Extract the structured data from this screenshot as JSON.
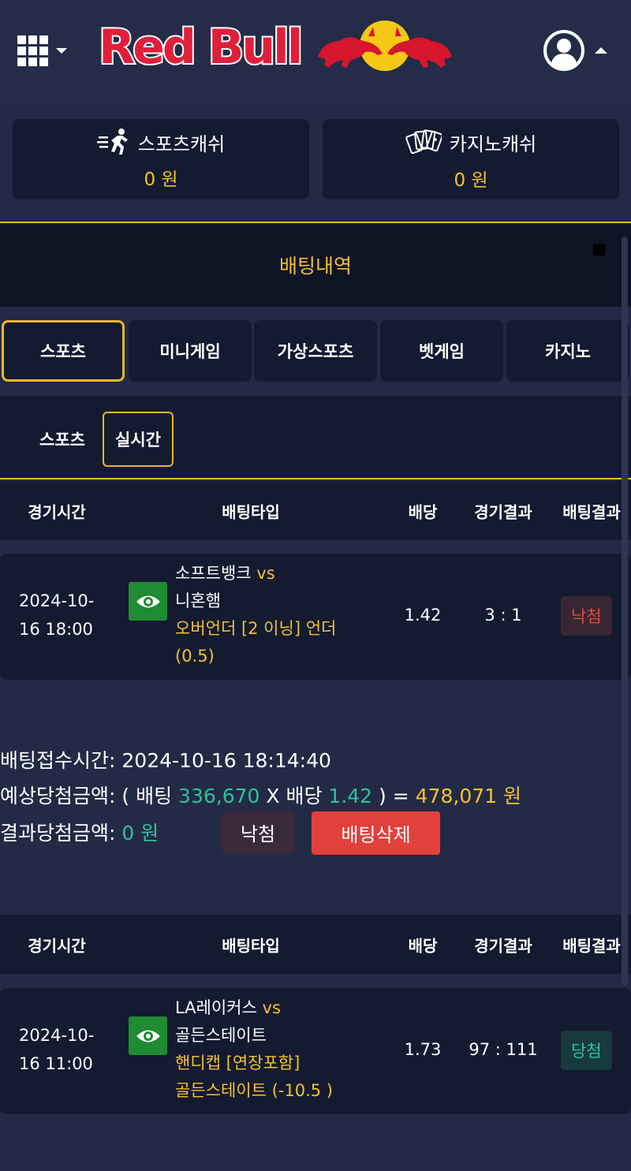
{
  "header": {
    "logo_text": "Red Bull",
    "icons": [
      "grid-menu-icon",
      "chevron-down-icon",
      "red-bull-bulls-logo",
      "user-avatar-icon",
      "caret-up-icon"
    ]
  },
  "cash": [
    {
      "label": "스포츠캐쉬",
      "value": "0 원",
      "icon": "running-sports-icon"
    },
    {
      "label": "카지노캐쉬",
      "value": "0 원",
      "icon": "playing-cards-icon"
    }
  ],
  "section_title": "배팅내역",
  "tabs": [
    "스포츠",
    "미니게임",
    "가상스포츠",
    "벳게임",
    "카지노"
  ],
  "subtabs": [
    "스포츠",
    "실시간"
  ],
  "table_headers": [
    "경기시간",
    "배팅타입",
    "배당",
    "경기결과",
    "배팅결과"
  ],
  "bets": [
    {
      "date_line1": "2024-10-",
      "date_line2": "16 18:00",
      "team_home": "소프트뱅크",
      "vs": "vs",
      "team_away": "니혼햄",
      "market_line1": "오버언더 [2 이닝] 언더",
      "market_line2": "(0.5)",
      "odds": "1.42",
      "score": "3 : 1",
      "result": "낙첨",
      "receipt": {
        "time_label": "배팅접수시간:",
        "time_value": "2024-10-16 18:14:40",
        "expected_label": "예상당첨금액:",
        "expected_open": "( 배팅",
        "stake": "336,670",
        "times": "X 배당",
        "odds": "1.42",
        "equals": ") =",
        "expected_amount": "478,071 원",
        "result_label": "결과당첨금액:",
        "result_amount": "0 원",
        "status_button": "낙첨",
        "delete_button": "배팅삭제"
      }
    },
    {
      "date_line1": "2024-10-",
      "date_line2": "16 11:00",
      "team_home": "LA레이커스",
      "vs": "vs",
      "team_away": "골든스테이트",
      "market_line1": "핸디캡 [연장포함]",
      "market_line2": "골든스테이트 (-10.5 )",
      "odds": "1.73",
      "score": "97 : 111",
      "result": "당첨"
    }
  ],
  "colors": {
    "background": "#232a45",
    "panel": "#141a30",
    "accent": "#f2c230",
    "green": "#2fc29a",
    "red": "#e2403b"
  }
}
